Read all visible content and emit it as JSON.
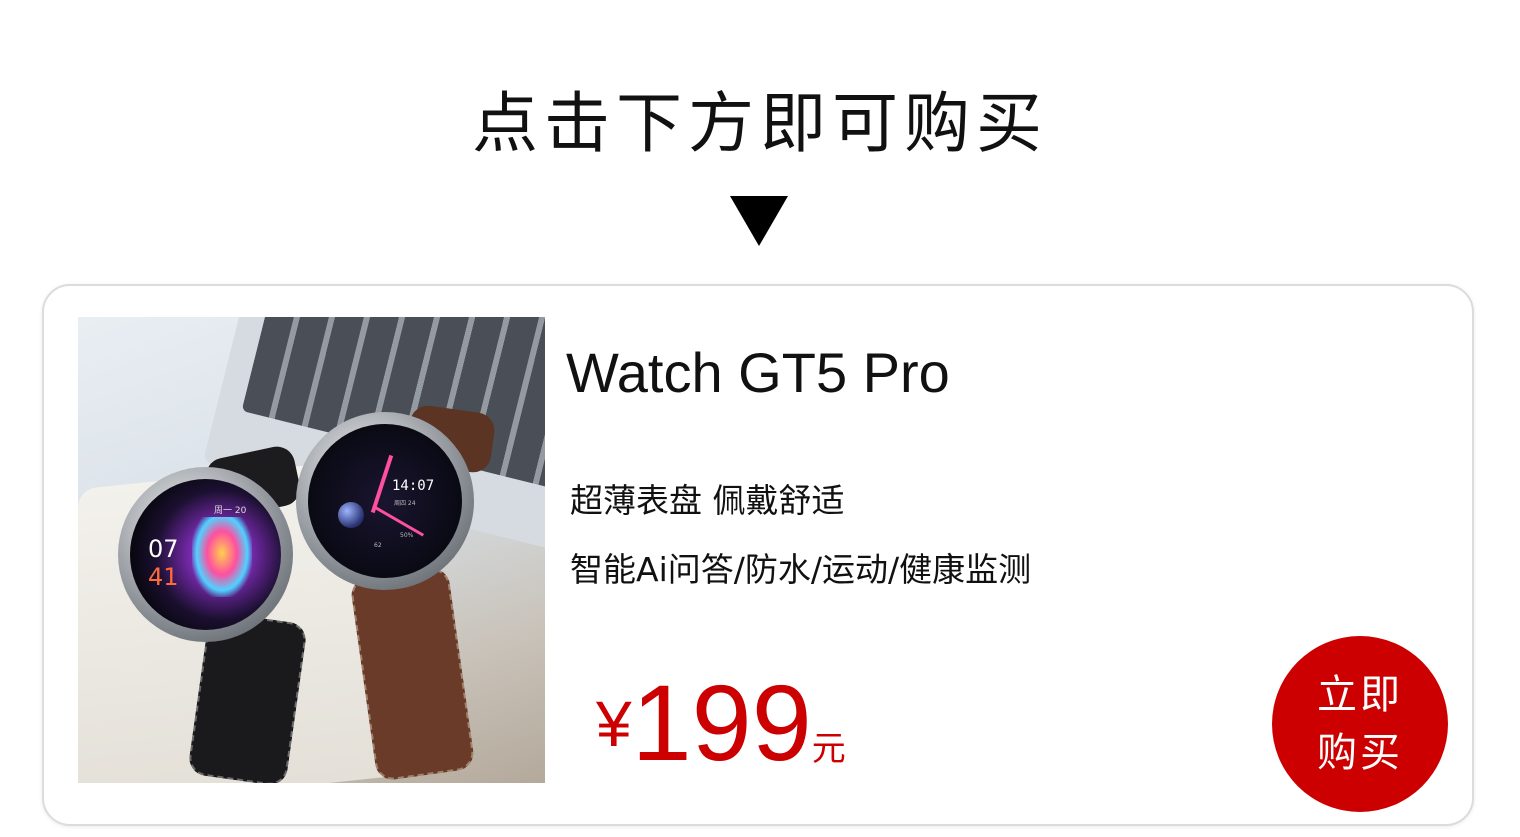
{
  "header": {
    "title": "点击下方即可购买"
  },
  "product": {
    "name": "Watch GT5 Pro",
    "feature_line_1": "超薄表盘 佩戴舒适",
    "feature_line_2": "智能Ai问答/防水/运动/健康监测",
    "price_currency": "¥",
    "price_value": "199",
    "price_unit": "元",
    "buy_label": "立即购买",
    "image_alt": "两款圆形智能手表，黑色与棕色皮质表带"
  },
  "watch_faces": {
    "left": {
      "time_hour": "07",
      "time_minute": "41",
      "date": "周一 20"
    },
    "right": {
      "time": "14:07",
      "day": "周四 24",
      "battery": "50%",
      "steps": "62"
    }
  },
  "colors": {
    "accent": "#cc0000",
    "text": "#111111",
    "card_border": "#dcdcdc"
  }
}
